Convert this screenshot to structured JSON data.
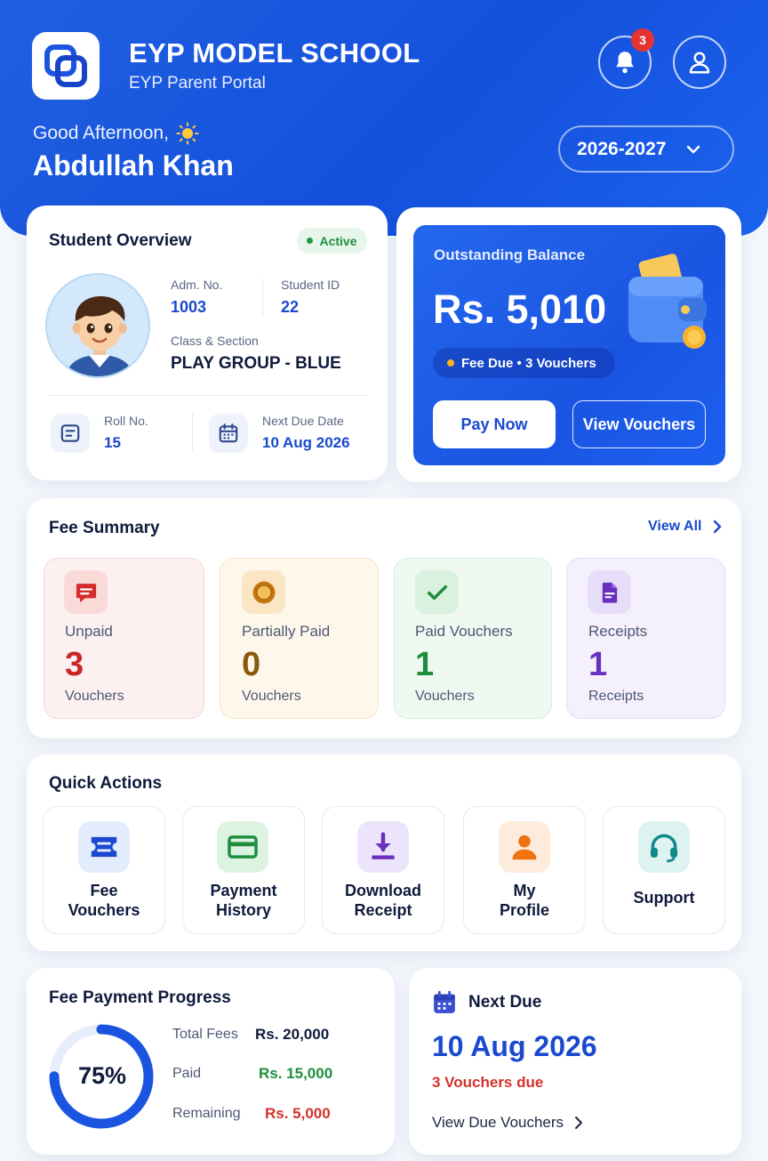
{
  "header": {
    "school_name": "EYP MODEL SCHOOL",
    "portal_name": "EYP Parent Portal",
    "notification_count": "3",
    "greeting": "Good Afternoon,",
    "user_name": "Abdullah Khan",
    "academic_year": "2026-2027"
  },
  "student": {
    "title": "Student Overview",
    "status": "Active",
    "adm_no_label": "Adm. No.",
    "adm_no": "1003",
    "student_id_label": "Student ID",
    "student_id": "22",
    "class_label": "Class & Section",
    "class_section": "PLAY GROUP - BLUE",
    "roll_label": "Roll No.",
    "roll_no": "15",
    "next_due_label": "Next Due Date",
    "next_due_date": "10 Aug 2026"
  },
  "balance": {
    "label": "Outstanding Balance",
    "amount": "Rs. 5,010",
    "status": "Fee Due • 3 Vouchers",
    "pay_label": "Pay Now",
    "view_label": "View Vouchers"
  },
  "fee_summary": {
    "title": "Fee Summary",
    "view_all": "View All",
    "tiles": [
      {
        "label": "Unpaid",
        "count": "3",
        "sub": "Vouchers",
        "color": "#c62828"
      },
      {
        "label": "Partially Paid",
        "count": "0",
        "sub": "Vouchers",
        "color": "#8a5a0b"
      },
      {
        "label": "Paid Vouchers",
        "count": "1",
        "sub": "Vouchers",
        "color": "#1e8e3e"
      },
      {
        "label": "Receipts",
        "count": "1",
        "sub": "Receipts",
        "color": "#6a2fbf"
      }
    ]
  },
  "quick_actions": {
    "title": "Quick Actions",
    "items": [
      {
        "label": "Fee Vouchers",
        "icon": "voucher-icon"
      },
      {
        "label": "Payment History",
        "icon": "card-icon"
      },
      {
        "label": "Download Receipt",
        "icon": "download-icon"
      },
      {
        "label": "My Profile",
        "icon": "person-icon"
      },
      {
        "label": "Support",
        "icon": "headset-icon"
      }
    ]
  },
  "progress": {
    "title": "Fee Payment Progress",
    "percent": 75,
    "percent_label": "75%",
    "total_label": "Total Fees",
    "total": "Rs. 20,000",
    "paid_label": "Paid",
    "paid": "Rs. 15,000",
    "remaining_label": "Remaining",
    "remaining": "Rs. 5,000"
  },
  "next_due": {
    "title": "Next Due",
    "date": "10 Aug 2026",
    "vouchers": "3 Vouchers due",
    "link": "View Due Vouchers"
  },
  "colors": {
    "primary": "#1a55e2",
    "accent_red": "#d3322a",
    "accent_green": "#1e8e3e"
  }
}
